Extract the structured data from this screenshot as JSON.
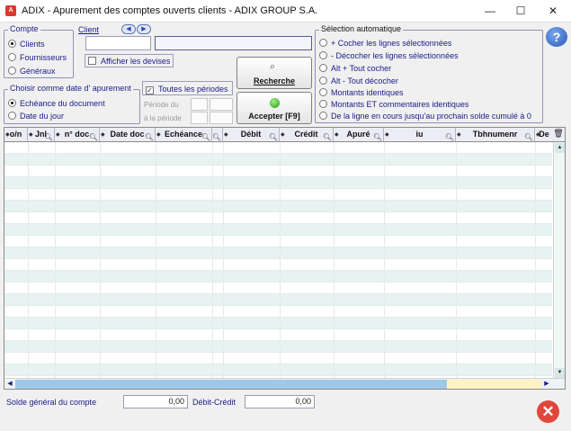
{
  "window": {
    "title": "ADIX - Apurement des comptes ouverts clients - ADIX GROUP S.A.",
    "app_icon": "adix-logo-icon",
    "minimize": "—",
    "maximize": "☐",
    "close": "✕"
  },
  "compte": {
    "label": "Compte",
    "options": [
      "Clients",
      "Fournisseurs",
      "Généraux"
    ],
    "selected": "Clients"
  },
  "client": {
    "label": "Client",
    "code_value": "",
    "name_value": "",
    "prev": "◀",
    "next": "▶"
  },
  "afficher_devises": {
    "label": "Afficher les devises",
    "checked": false
  },
  "date_apurement": {
    "label": "Choisir comme date d' apurement",
    "options": [
      "Echéance du document",
      "Date du jour"
    ],
    "selected": "Echéance du document"
  },
  "toutes_periodes": {
    "label": "Toutes les périodes",
    "checked": true
  },
  "periode": {
    "du_label": "Période du",
    "a_label": "à la période"
  },
  "buttons": {
    "recherche": "Recherche",
    "accepter": "Accepter [F9]"
  },
  "selection_auto": {
    "label": "Sélection automatique",
    "options": [
      "+ Cocher les lignes sélectionnées",
      "- Décocher les lignes sélectionnées",
      "Alt + Tout cocher",
      "Alt - Tout décocher",
      "Montants identiques",
      "Montants ET commentaires identiques",
      "De la ligne en cours jusqu'au prochain solde cumulé à 0"
    ]
  },
  "grid": {
    "columns": [
      {
        "label": "o/n"
      },
      {
        "label": "Jnl"
      },
      {
        "label": "n° doc"
      },
      {
        "label": "Date doc"
      },
      {
        "label": "Echéance"
      },
      {
        "label": ""
      },
      {
        "label": "Débit"
      },
      {
        "label": "Crédit"
      },
      {
        "label": "Apuré"
      },
      {
        "label": "iu"
      },
      {
        "label": "Tbhnumenr"
      },
      {
        "label": "De"
      }
    ],
    "row_count": 20
  },
  "footer": {
    "solde_label": "Solde général du compte",
    "solde_value": "0,00",
    "debit_credit_label": "Débit-Crédit",
    "debit_credit_value": "0,00"
  },
  "colors": {
    "accent": "#1a1a8c",
    "row_alt": "#e6f3f1",
    "close_red": "#e0473a"
  }
}
